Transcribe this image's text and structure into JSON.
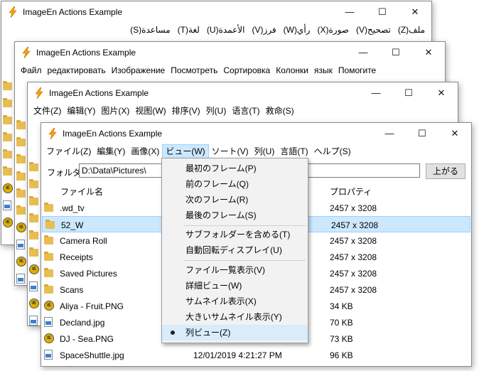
{
  "app_title": "ImageEn Actions Example",
  "window_controls": {
    "minimize": "—",
    "maximize": "☐",
    "close": "✕"
  },
  "windows": {
    "arabic": {
      "menu": [
        "ملف(Z)",
        "تصحيح(V)",
        "صورة(X)",
        "رأي(W)",
        "فرز(V)",
        "الأعمدة(U)",
        "لغة(T)",
        "مساعدة(S)"
      ]
    },
    "russian": {
      "menu": [
        "Файл",
        "редактировать",
        "Изображение",
        "Посмотреть",
        "Сортировка",
        "Колонки",
        "язык",
        "Помогите"
      ]
    },
    "chinese": {
      "menu": [
        "文件(Z)",
        "编辑(Y)",
        "图片(X)",
        "视图(W)",
        "排序(V)",
        "列(U)",
        "语言(T)",
        "救命(S)"
      ]
    },
    "japanese": {
      "menu": [
        "ファイル(Z)",
        "編集(Y)",
        "画像(X)",
        "ビュー(W)",
        "ソート(V)",
        "列(U)",
        "言語(T)",
        "ヘルプ(S)"
      ],
      "folder_label": "フォルダ:",
      "folder_value": "D:\\Data\\Pictures\\",
      "up_button": "上がる",
      "columns": {
        "name": "ファイル名",
        "properties": "プロパティ"
      },
      "rows": [
        {
          "name": ".wd_tv",
          "date": "",
          "prop": "2457 x 3208",
          "icon": "folder-icon"
        },
        {
          "name": "52_W",
          "date": "",
          "prop": "2457 x 3208",
          "icon": "folder-icon"
        },
        {
          "name": "Camera Roll",
          "date": "",
          "prop": "2457 x 3208",
          "icon": "folder-icon"
        },
        {
          "name": "Receipts",
          "date": "",
          "prop": "2457 x 3208",
          "icon": "folder-icon"
        },
        {
          "name": "Saved Pictures",
          "date": "",
          "prop": "2457 x 3208",
          "icon": "folder-icon"
        },
        {
          "name": "Scans",
          "date": "",
          "prop": "2457 x 3208",
          "icon": "folder-icon"
        },
        {
          "name": "Aliya - Fruit.PNG",
          "date": "",
          "prop": "34 KB",
          "icon": "png-file-icon"
        },
        {
          "name": "Decland.jpg",
          "date": "",
          "prop": "70 KB",
          "icon": "jpg-file-icon"
        },
        {
          "name": "DJ - Sea.PNG",
          "date": "",
          "prop": "73 KB",
          "icon": "png-file-icon"
        },
        {
          "name": "SpaceShuttle.jpg",
          "date": "12/01/2019 4:21:27 PM",
          "prop": "96 KB",
          "icon": "jpg-file-icon"
        }
      ],
      "selected_row": "52_W",
      "view_menu": [
        "最初のフレーム(P)",
        "前のフレーム(Q)",
        "次のフレーム(R)",
        "最後のフレーム(S)",
        "サブフォルダーを含める(T)",
        "自動回転ディスプレイ(U)",
        "ファイル一覧表示(V)",
        "詳細ビュー(W)",
        "サムネイル表示(X)",
        "大きいサムネイル表示(Y)",
        "列ビュー(Z)"
      ],
      "view_menu_checked": "列ビュー(Z)"
    }
  },
  "colors": {
    "selection": "#cce8ff",
    "selection_border": "#99d1ff",
    "folder": "#e8bd52",
    "menu_bg": "#f2f2f2"
  }
}
